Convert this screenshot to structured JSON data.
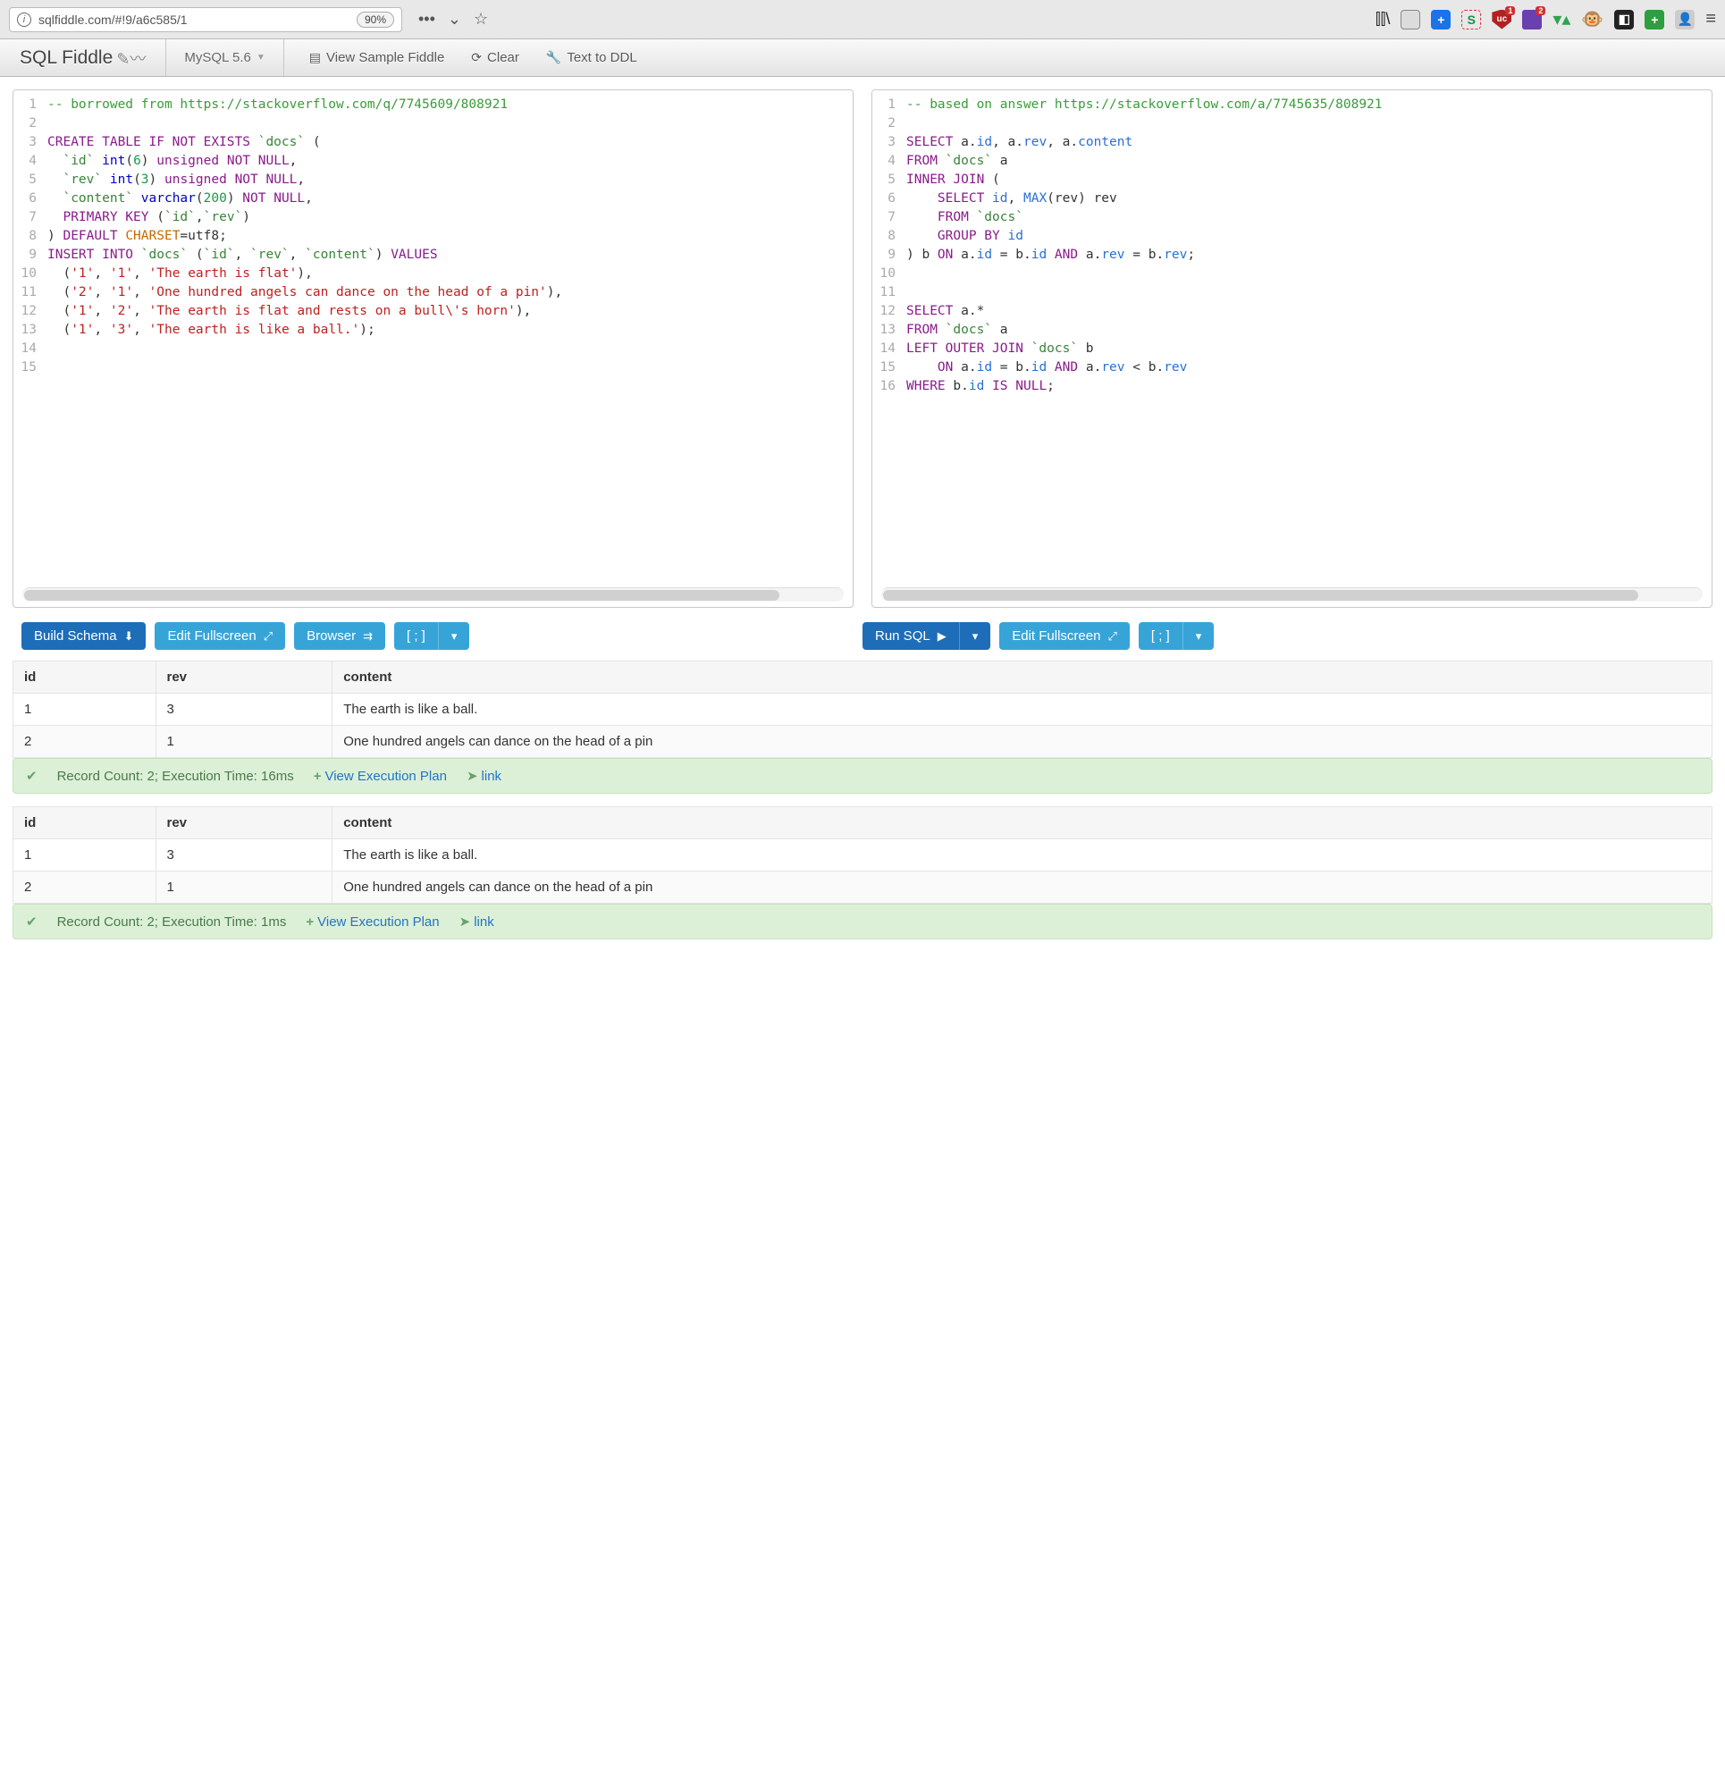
{
  "browser": {
    "url": "sqlfiddle.com/#!9/a6c585/1",
    "zoom": "90%"
  },
  "navbar": {
    "brand": "SQL Fiddle",
    "db": "MySQL 5.6",
    "view_sample": "View Sample Fiddle",
    "clear": "Clear",
    "text_to_ddl": "Text to DDL"
  },
  "schema_editor": {
    "lines": [
      [
        {
          "t": "-- borrowed from https://stackoverflow.com/q/7745609/808921",
          "c": "c-comment"
        }
      ],
      [],
      [
        {
          "t": "CREATE TABLE IF NOT EXISTS",
          "c": "c-keyword"
        },
        {
          "t": " "
        },
        {
          "t": "`docs`",
          "c": "c-back"
        },
        {
          "t": " ("
        }
      ],
      [
        {
          "t": "  "
        },
        {
          "t": "`id`",
          "c": "c-back"
        },
        {
          "t": " "
        },
        {
          "t": "int",
          "c": "c-type"
        },
        {
          "t": "("
        },
        {
          "t": "6",
          "c": "c-num"
        },
        {
          "t": ") "
        },
        {
          "t": "unsigned NOT NULL",
          "c": "c-keyword"
        },
        {
          "t": ","
        }
      ],
      [
        {
          "t": "  "
        },
        {
          "t": "`rev`",
          "c": "c-back"
        },
        {
          "t": " "
        },
        {
          "t": "int",
          "c": "c-type"
        },
        {
          "t": "("
        },
        {
          "t": "3",
          "c": "c-num"
        },
        {
          "t": ") "
        },
        {
          "t": "unsigned NOT NULL",
          "c": "c-keyword"
        },
        {
          "t": ","
        }
      ],
      [
        {
          "t": "  "
        },
        {
          "t": "`content`",
          "c": "c-back"
        },
        {
          "t": " "
        },
        {
          "t": "varchar",
          "c": "c-type"
        },
        {
          "t": "("
        },
        {
          "t": "200",
          "c": "c-num"
        },
        {
          "t": ") "
        },
        {
          "t": "NOT NULL",
          "c": "c-keyword"
        },
        {
          "t": ","
        }
      ],
      [
        {
          "t": "  "
        },
        {
          "t": "PRIMARY KEY",
          "c": "c-keyword"
        },
        {
          "t": " ("
        },
        {
          "t": "`id`",
          "c": "c-back"
        },
        {
          "t": ","
        },
        {
          "t": "`rev`",
          "c": "c-back"
        },
        {
          "t": ")"
        }
      ],
      [
        {
          "t": ") "
        },
        {
          "t": "DEFAULT",
          "c": "c-keyword"
        },
        {
          "t": " "
        },
        {
          "t": "CHARSET",
          "c": "c-charset"
        },
        {
          "t": "=utf8;"
        }
      ],
      [
        {
          "t": "INSERT INTO",
          "c": "c-keyword"
        },
        {
          "t": " "
        },
        {
          "t": "`docs`",
          "c": "c-back"
        },
        {
          "t": " ("
        },
        {
          "t": "`id`",
          "c": "c-back"
        },
        {
          "t": ", "
        },
        {
          "t": "`rev`",
          "c": "c-back"
        },
        {
          "t": ", "
        },
        {
          "t": "`content`",
          "c": "c-back"
        },
        {
          "t": ") "
        },
        {
          "t": "VALUES",
          "c": "c-keyword"
        }
      ],
      [
        {
          "t": "  ("
        },
        {
          "t": "'1'",
          "c": "c-str"
        },
        {
          "t": ", "
        },
        {
          "t": "'1'",
          "c": "c-str"
        },
        {
          "t": ", "
        },
        {
          "t": "'The earth is flat'",
          "c": "c-str"
        },
        {
          "t": "),"
        }
      ],
      [
        {
          "t": "  ("
        },
        {
          "t": "'2'",
          "c": "c-str"
        },
        {
          "t": ", "
        },
        {
          "t": "'1'",
          "c": "c-str"
        },
        {
          "t": ", "
        },
        {
          "t": "'One hundred angels can dance on the head of a pin'",
          "c": "c-str"
        },
        {
          "t": "),"
        }
      ],
      [
        {
          "t": "  ("
        },
        {
          "t": "'1'",
          "c": "c-str"
        },
        {
          "t": ", "
        },
        {
          "t": "'2'",
          "c": "c-str"
        },
        {
          "t": ", "
        },
        {
          "t": "'The earth is flat and rests on a bull\\'s horn'",
          "c": "c-str"
        },
        {
          "t": "),"
        }
      ],
      [
        {
          "t": "  ("
        },
        {
          "t": "'1'",
          "c": "c-str"
        },
        {
          "t": ", "
        },
        {
          "t": "'3'",
          "c": "c-str"
        },
        {
          "t": ", "
        },
        {
          "t": "'The earth is like a ball.'",
          "c": "c-str"
        },
        {
          "t": ");"
        }
      ],
      [],
      []
    ]
  },
  "query_editor": {
    "lines": [
      [
        {
          "t": "-- based on answer https://stackoverflow.com/a/7745635/808921",
          "c": "c-comment"
        }
      ],
      [],
      [
        {
          "t": "SELECT",
          "c": "c-keyword"
        },
        {
          "t": " a."
        },
        {
          "t": "id",
          "c": "c-id"
        },
        {
          "t": ", a."
        },
        {
          "t": "rev",
          "c": "c-id"
        },
        {
          "t": ", a."
        },
        {
          "t": "content",
          "c": "c-id"
        }
      ],
      [
        {
          "t": "FROM",
          "c": "c-keyword"
        },
        {
          "t": " "
        },
        {
          "t": "`docs`",
          "c": "c-back"
        },
        {
          "t": " a"
        }
      ],
      [
        {
          "t": "INNER JOIN",
          "c": "c-keyword"
        },
        {
          "t": " ("
        }
      ],
      [
        {
          "t": "    "
        },
        {
          "t": "SELECT",
          "c": "c-keyword"
        },
        {
          "t": " "
        },
        {
          "t": "id",
          "c": "c-id"
        },
        {
          "t": ", "
        },
        {
          "t": "MAX",
          "c": "c-func"
        },
        {
          "t": "(rev) rev"
        }
      ],
      [
        {
          "t": "    "
        },
        {
          "t": "FROM",
          "c": "c-keyword"
        },
        {
          "t": " "
        },
        {
          "t": "`docs`",
          "c": "c-back"
        }
      ],
      [
        {
          "t": "    "
        },
        {
          "t": "GROUP BY",
          "c": "c-keyword"
        },
        {
          "t": " "
        },
        {
          "t": "id",
          "c": "c-id"
        }
      ],
      [
        {
          "t": ") b "
        },
        {
          "t": "ON",
          "c": "c-keyword"
        },
        {
          "t": " a."
        },
        {
          "t": "id",
          "c": "c-id"
        },
        {
          "t": " = b."
        },
        {
          "t": "id",
          "c": "c-id"
        },
        {
          "t": " "
        },
        {
          "t": "AND",
          "c": "c-keyword"
        },
        {
          "t": " a."
        },
        {
          "t": "rev",
          "c": "c-id"
        },
        {
          "t": " = b."
        },
        {
          "t": "rev",
          "c": "c-id"
        },
        {
          "t": ";"
        }
      ],
      [],
      [],
      [
        {
          "t": "SELECT",
          "c": "c-keyword"
        },
        {
          "t": " a.*"
        }
      ],
      [
        {
          "t": "FROM",
          "c": "c-keyword"
        },
        {
          "t": " "
        },
        {
          "t": "`docs`",
          "c": "c-back"
        },
        {
          "t": " a"
        }
      ],
      [
        {
          "t": "LEFT OUTER JOIN",
          "c": "c-keyword"
        },
        {
          "t": " "
        },
        {
          "t": "`docs`",
          "c": "c-back"
        },
        {
          "t": " b"
        }
      ],
      [
        {
          "t": "    "
        },
        {
          "t": "ON",
          "c": "c-keyword"
        },
        {
          "t": " a."
        },
        {
          "t": "id",
          "c": "c-id"
        },
        {
          "t": " = b."
        },
        {
          "t": "id",
          "c": "c-id"
        },
        {
          "t": " "
        },
        {
          "t": "AND",
          "c": "c-keyword"
        },
        {
          "t": " a."
        },
        {
          "t": "rev",
          "c": "c-id"
        },
        {
          "t": " < b."
        },
        {
          "t": "rev",
          "c": "c-id"
        }
      ],
      [
        {
          "t": "WHERE",
          "c": "c-keyword"
        },
        {
          "t": " b."
        },
        {
          "t": "id",
          "c": "c-id"
        },
        {
          "t": " "
        },
        {
          "t": "IS NULL",
          "c": "c-keyword"
        },
        {
          "t": ";"
        }
      ]
    ]
  },
  "toolbar": {
    "build_schema": "Build Schema",
    "edit_fullscreen": "Edit Fullscreen",
    "browser": "Browser",
    "format": "[ ; ]",
    "run_sql": "Run SQL"
  },
  "results": [
    {
      "columns": [
        "id",
        "rev",
        "content"
      ],
      "rows": [
        [
          "1",
          "3",
          "The earth is like a ball."
        ],
        [
          "2",
          "1",
          "One hundred angels can dance on the head of a pin"
        ]
      ],
      "status": "Record Count: 2; Execution Time: 16ms",
      "plan_label": "View Execution Plan",
      "link_label": "link"
    },
    {
      "columns": [
        "id",
        "rev",
        "content"
      ],
      "rows": [
        [
          "1",
          "3",
          "The earth is like a ball."
        ],
        [
          "2",
          "1",
          "One hundred angels can dance on the head of a pin"
        ]
      ],
      "status": "Record Count: 2; Execution Time: 1ms",
      "plan_label": "View Execution Plan",
      "link_label": "link"
    }
  ]
}
